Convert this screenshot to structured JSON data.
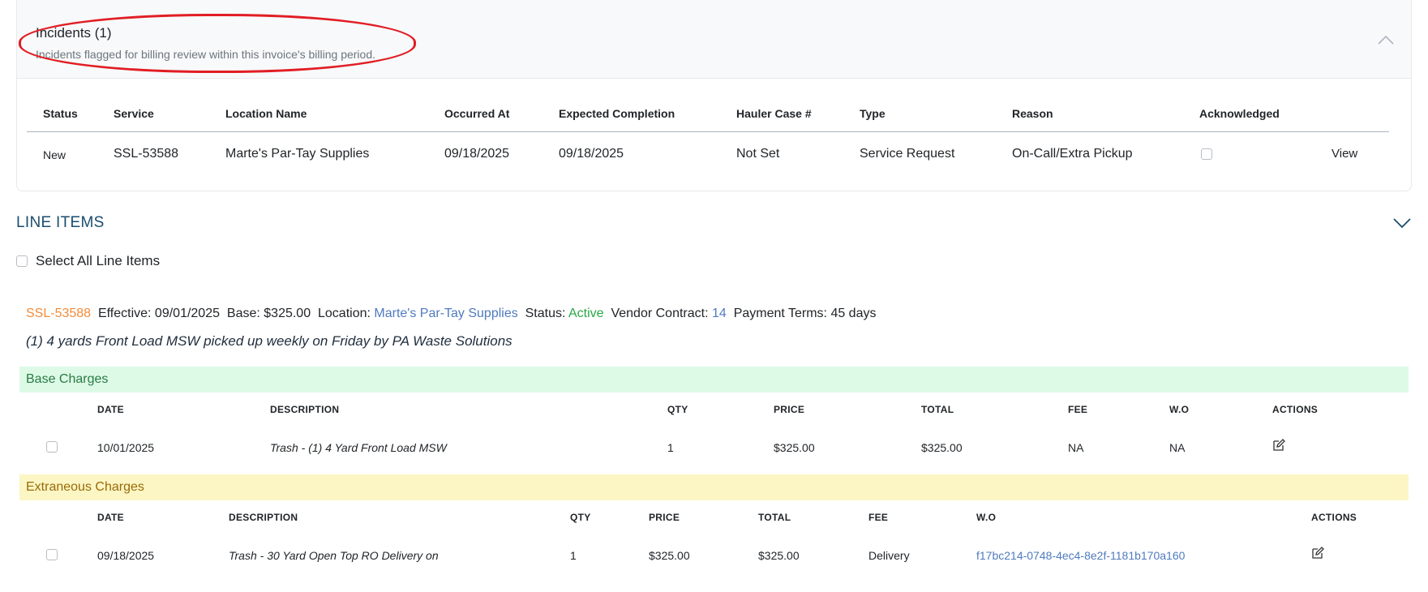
{
  "incidents": {
    "title": "Incidents (1)",
    "subtitle": "Incidents flagged for billing review within this invoice's billing period.",
    "columns": [
      "Status",
      "Service",
      "Location Name",
      "Occurred At",
      "Expected Completion",
      "Hauler Case #",
      "Type",
      "Reason",
      "Acknowledged"
    ],
    "rows": [
      {
        "status": "New",
        "service": "SSL-53588",
        "location": "Marte's Par-Tay Supplies",
        "occurred_at": "09/18/2025",
        "expected_completion": "09/18/2025",
        "hauler_case": "Not Set",
        "type": "Service Request",
        "reason": "On-Call/Extra Pickup",
        "acknowledged": false,
        "action": "View"
      }
    ]
  },
  "line_items": {
    "title": "LINE ITEMS",
    "select_all_label": "Select All Line Items",
    "service": {
      "id": "SSL-53588",
      "effective_label": "Effective:",
      "effective": "09/01/2025",
      "base_label": "Base:",
      "base": "$325.00",
      "location_label": "Location:",
      "location": "Marte's Par-Tay Supplies",
      "status_label": "Status:",
      "status": "Active",
      "vendor_contract_label": "Vendor Contract:",
      "vendor_contract": "14",
      "payment_terms_label": "Payment Terms:",
      "payment_terms": "45 days",
      "description": "(1) 4 yards Front Load MSW picked up weekly on Friday by PA Waste Solutions"
    },
    "base_charges": {
      "title": "Base Charges",
      "columns": [
        "DATE",
        "DESCRIPTION",
        "QTY",
        "PRICE",
        "TOTAL",
        "FEE",
        "W.O",
        "ACTIONS"
      ],
      "rows": [
        {
          "date": "10/01/2025",
          "description": "Trash - (1) 4 Yard Front Load MSW",
          "qty": "1",
          "price": "$325.00",
          "total": "$325.00",
          "fee": "NA",
          "wo": "NA"
        }
      ]
    },
    "extraneous_charges": {
      "title": "Extraneous Charges",
      "columns": [
        "DATE",
        "DESCRIPTION",
        "QTY",
        "PRICE",
        "TOTAL",
        "FEE",
        "W.O",
        "ACTIONS"
      ],
      "rows": [
        {
          "date": "09/18/2025",
          "description": "Trash - 30 Yard Open Top RO Delivery on",
          "qty": "1",
          "price": "$325.00",
          "total": "$325.00",
          "fee": "Delivery",
          "wo": "f17bc214-0748-4ec4-8e2f-1181b170a160"
        }
      ]
    }
  },
  "colors": {
    "highlight": "#e11d24",
    "link": "#4f7bbf",
    "active_status": "#28a745",
    "service_id": "#f28c3a",
    "base_band": "#dcfae6",
    "extra_band": "#fcf6c4"
  }
}
